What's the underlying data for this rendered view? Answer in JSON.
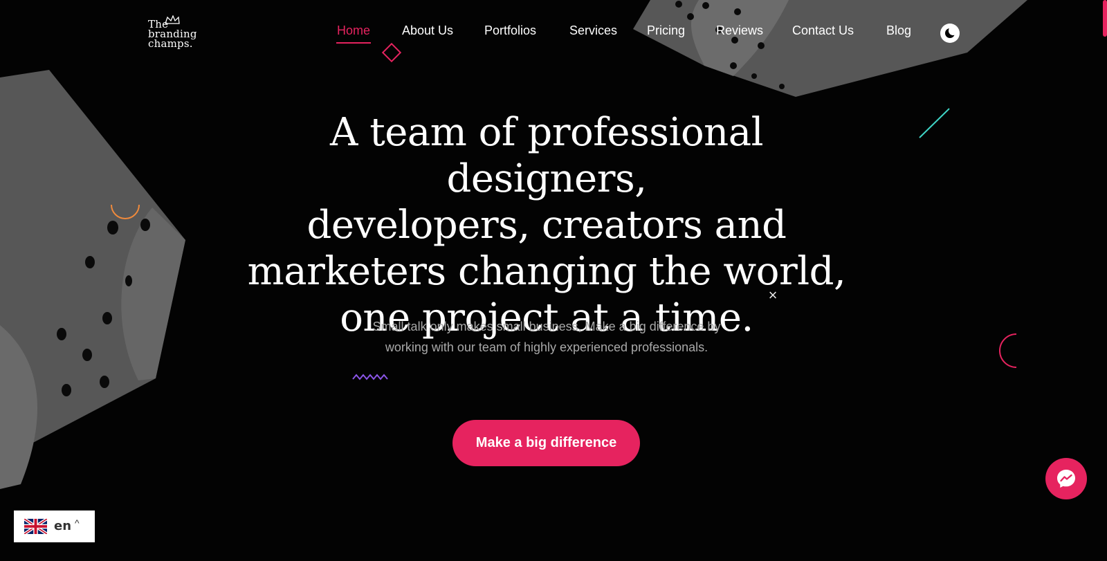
{
  "brand": {
    "logo_words": [
      "The",
      "branding",
      "champs."
    ],
    "accent_color": "#e6235f"
  },
  "nav": {
    "items": [
      {
        "label": "Home",
        "active": true
      },
      {
        "label": "About Us",
        "active": false
      },
      {
        "label": "Portfolios",
        "active": false
      },
      {
        "label": "Services",
        "active": false
      },
      {
        "label": "Pricing",
        "active": false
      },
      {
        "label": "Reviews",
        "active": false
      },
      {
        "label": "Contact Us",
        "active": false
      },
      {
        "label": "Blog",
        "active": false
      }
    ],
    "theme_toggle_icon": "moon-icon"
  },
  "hero": {
    "title_lines": [
      "A team of professional designers,",
      "developers, creators and",
      "marketers changing the world,",
      "one project at a time."
    ],
    "subtitle_lines": [
      "Small talk only makes small business, Make a big difference by",
      "working with our team of highly experienced professionals."
    ],
    "cta_label": "Make a big difference",
    "close_icon": "close-icon"
  },
  "widgets": {
    "messenger_icon": "messenger-icon",
    "language": {
      "code": "en",
      "flag_icon": "uk-flag-icon",
      "caret_icon": "chevron-up-icon"
    }
  },
  "colors": {
    "background": "#030303",
    "shape_gray": "#555555",
    "shape_gray_light": "#666666",
    "decor_cyan": "#3fd6c7",
    "decor_orange": "#f08a3c",
    "decor_purple": "#8a55e6"
  }
}
